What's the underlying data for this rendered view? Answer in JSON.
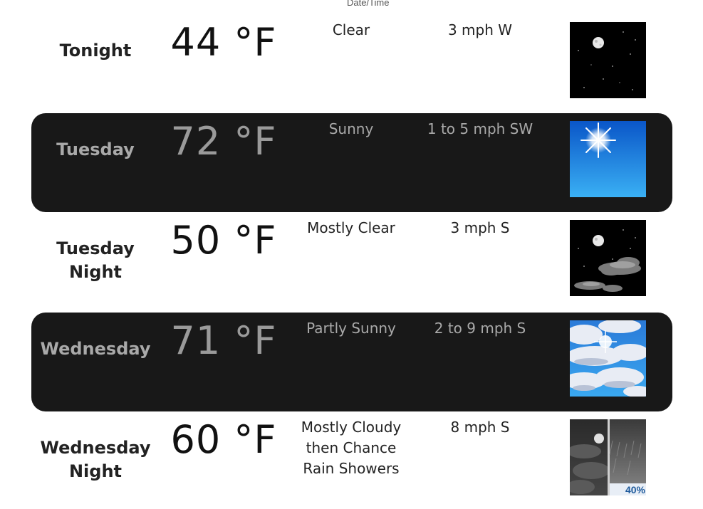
{
  "header": {
    "datetime_label": "Date/Time"
  },
  "forecast": [
    {
      "period": "Tonight",
      "temperature": "44 °F",
      "condition": "Clear",
      "wind": "3 mph W",
      "icon": "night-clear-icon"
    },
    {
      "period": "Tuesday",
      "temperature": "72 °F",
      "condition": "Sunny",
      "wind": "1 to 5 mph SW",
      "icon": "sunny-icon"
    },
    {
      "period": "Tuesday Night",
      "temperature": "50 °F",
      "condition": "Mostly Clear",
      "wind": "3 mph S",
      "icon": "night-mostly-clear-icon"
    },
    {
      "period": "Wednesday",
      "temperature": "71 °F",
      "condition": "Partly Sunny",
      "wind": "2 to 9 mph S",
      "icon": "partly-sunny-icon"
    },
    {
      "period": "Wednesday Night",
      "temperature": "60 °F",
      "condition": "Mostly Cloudy then Chance Rain Showers",
      "wind": "8 mph S",
      "icon": "night-cloudy-rain-icon",
      "precip_chance": "40%"
    }
  ],
  "colors": {
    "dark_row_bg": "#181818",
    "dark_row_text": "#a9a9a9",
    "light_row_text": "#222222"
  }
}
